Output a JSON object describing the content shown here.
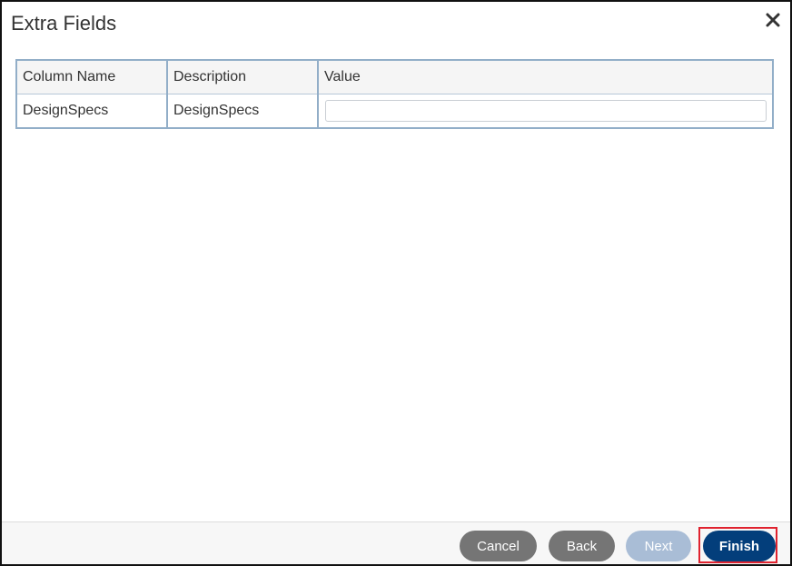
{
  "dialog": {
    "title": "Extra Fields",
    "close_icon": "close-icon"
  },
  "grid": {
    "headers": [
      "Column Name",
      "Description",
      "Value"
    ],
    "rows": [
      {
        "column_name": "DesignSpecs",
        "description": "DesignSpecs",
        "value": ""
      }
    ]
  },
  "footer": {
    "cancel_label": "Cancel",
    "back_label": "Back",
    "next_label": "Next",
    "finish_label": "Finish"
  },
  "colors": {
    "primary_button": "#033e7b",
    "secondary_button": "#757575",
    "disabled_button": "#a9bdd6",
    "highlight": "#e0232f",
    "grid_border": "#92aec8"
  }
}
